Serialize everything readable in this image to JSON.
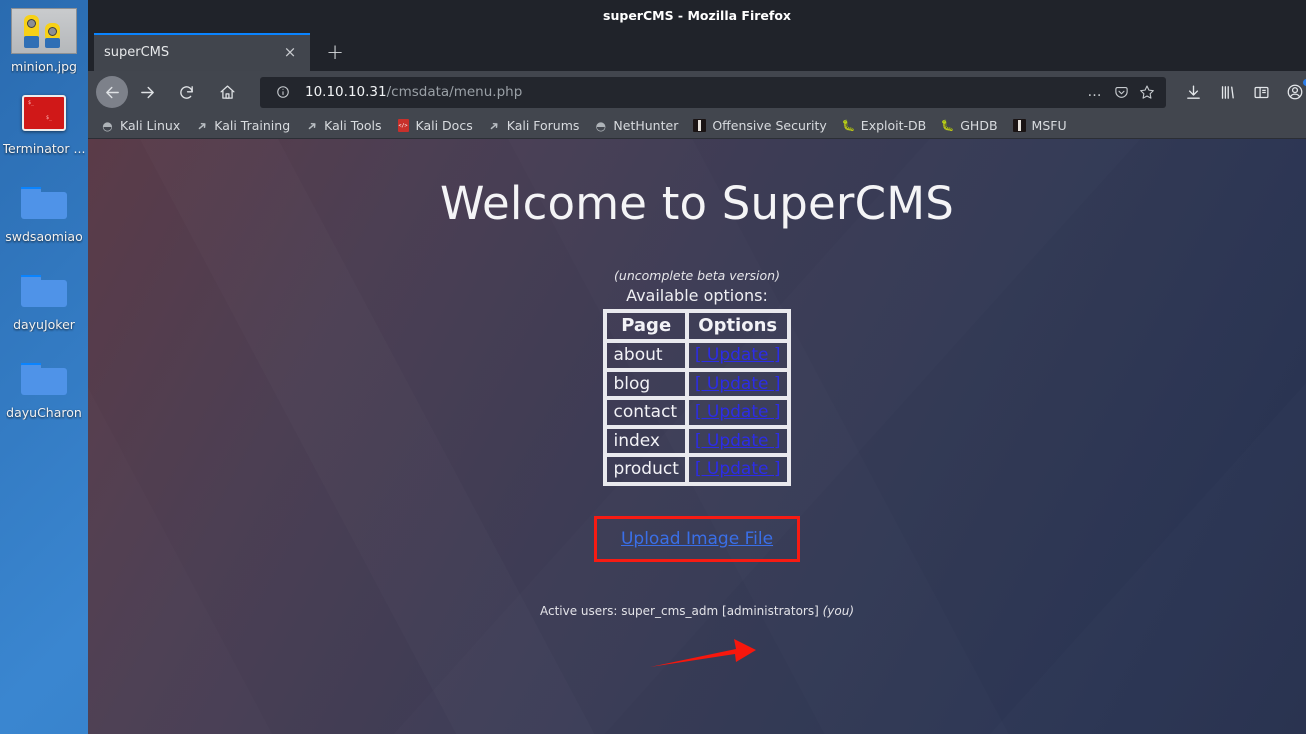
{
  "desktop": {
    "icons": [
      {
        "label": "minion.jpg",
        "icon": "image-thumbnail-icon"
      },
      {
        "label": "Terminator ...",
        "icon": "terminal-app-icon"
      },
      {
        "label": "swdsaomiao",
        "icon": "folder-icon"
      },
      {
        "label": "dayuJoker",
        "icon": "folder-icon"
      },
      {
        "label": "dayuCharon",
        "icon": "folder-icon"
      }
    ]
  },
  "browser": {
    "window_title": "superCMS - Mozilla Firefox",
    "tab": {
      "title": "superCMS",
      "close_label": "×"
    },
    "new_tab_label": "+",
    "nav": {
      "back": "back-button",
      "forward": "forward-button",
      "reload": "reload-button",
      "home": "home-button"
    },
    "urlbar": {
      "host": "10.10.10.31",
      "path": "/cmsdata/menu.php",
      "info_icon": "page-info-icon",
      "more_label": "…",
      "pocket_icon": "pocket-icon",
      "bookmark_icon": "star-icon"
    },
    "toolbar_icons": [
      "downloads-icon",
      "library-icon",
      "sidebar-icon",
      "account-icon"
    ],
    "bookmarks": [
      {
        "label": "Kali Linux",
        "icon": "dragon-icon"
      },
      {
        "label": "Kali Training",
        "icon": "wrench-icon"
      },
      {
        "label": "Kali Tools",
        "icon": "wrench-icon"
      },
      {
        "label": "Kali Docs",
        "icon": "book-icon"
      },
      {
        "label": "Kali Forums",
        "icon": "wrench-icon"
      },
      {
        "label": "NetHunter",
        "icon": "dragon-icon"
      },
      {
        "label": "Offensive Security",
        "icon": "dagger-icon"
      },
      {
        "label": "Exploit-DB",
        "icon": "bug-icon"
      },
      {
        "label": "GHDB",
        "icon": "bug-icon"
      },
      {
        "label": "MSFU",
        "icon": "dagger-icon"
      }
    ]
  },
  "page": {
    "title": "Welcome to SuperCMS",
    "subtitle": "(uncomplete beta version)",
    "available_label": "Available options:",
    "table": {
      "headers": [
        "Page",
        "Options"
      ],
      "rows": [
        {
          "page": "about",
          "option": "[ Update ]"
        },
        {
          "page": "blog",
          "option": "[ Update ]"
        },
        {
          "page": "contact",
          "option": "[ Update ]"
        },
        {
          "page": "index",
          "option": "[ Update ]"
        },
        {
          "page": "product",
          "option": "[ Update ]"
        }
      ]
    },
    "upload_link": "Upload Image File",
    "footer": {
      "prefix": "Active users: super_cms_adm [administrators] ",
      "you": "(you)"
    }
  },
  "annotation": {
    "arrow_color": "#f7170d",
    "highlight_color": "#f71b13"
  }
}
